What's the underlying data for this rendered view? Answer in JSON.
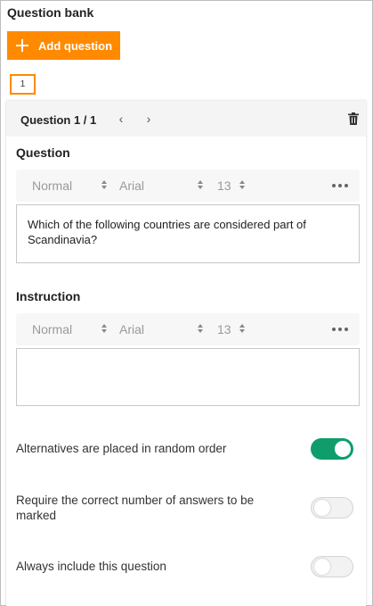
{
  "panel": {
    "title": "Question bank"
  },
  "add_button": {
    "label": "Add question"
  },
  "question_tabs": [
    {
      "label": "1"
    }
  ],
  "card": {
    "header": {
      "title": "Question 1 / 1",
      "prev_icon": "chevron-left-icon",
      "next_icon": "chevron-right-icon",
      "delete_icon": "trash-icon"
    },
    "question": {
      "label": "Question",
      "toolbar": {
        "style": "Normal",
        "font": "Arial",
        "size": "13"
      },
      "text": "Which of the following countries are considered part of Scandinavia?"
    },
    "instruction": {
      "label": "Instruction",
      "toolbar": {
        "style": "Normal",
        "font": "Arial",
        "size": "13"
      },
      "text": ""
    },
    "toggles": [
      {
        "label": "Alternatives are placed in random order",
        "on": true
      },
      {
        "label": "Require the correct number of answers to be marked",
        "on": false
      },
      {
        "label": "Always include this question",
        "on": false
      }
    ]
  },
  "colors": {
    "accent": "#ff8a00",
    "toggle_on": "#0f9d6b"
  }
}
